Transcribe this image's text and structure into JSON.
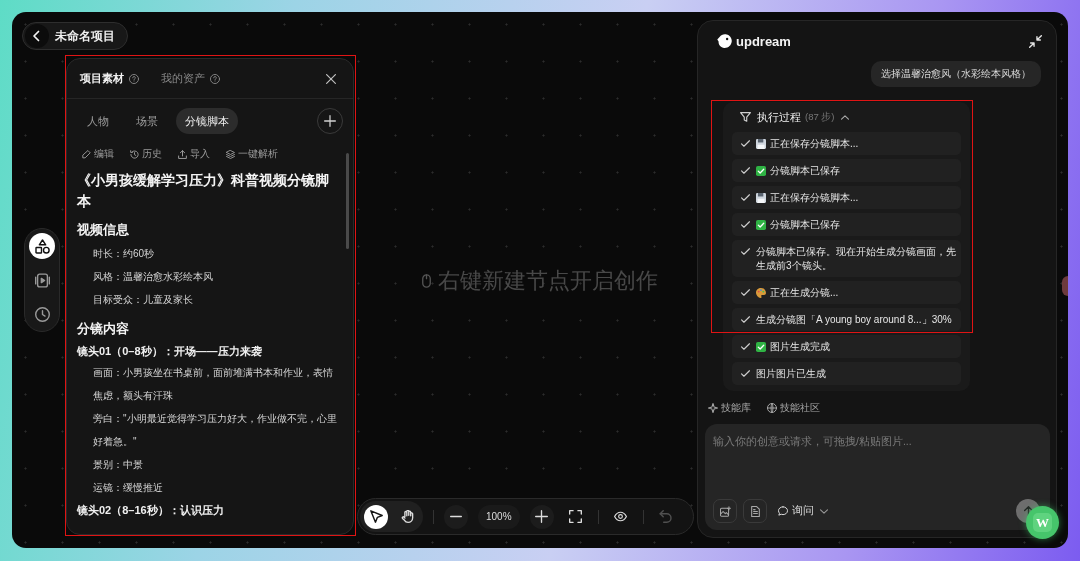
{
  "project": {
    "title": "未命名项目"
  },
  "rail": {
    "items": [
      {
        "kind": "shapes",
        "selected": true
      },
      {
        "kind": "video",
        "selected": false
      },
      {
        "kind": "history",
        "selected": false
      }
    ]
  },
  "asset_panel": {
    "highlighted": true,
    "header_tabs": [
      {
        "label": "项目素材",
        "selected": true
      },
      {
        "label": "我的资产",
        "selected": false
      }
    ],
    "category_tabs": [
      {
        "label": "人物",
        "selected": false
      },
      {
        "label": "场景",
        "selected": false
      },
      {
        "label": "分镜脚本",
        "selected": true
      }
    ],
    "actions": [
      {
        "kind": "edit",
        "label": "编辑"
      },
      {
        "kind": "history",
        "label": "历史"
      },
      {
        "kind": "import",
        "label": "导入"
      },
      {
        "kind": "parse",
        "label": "一键解析"
      }
    ],
    "document": {
      "title": "《小男孩缓解学习压力》科普视频分镜脚本",
      "blocks": [
        {
          "kind": "heading",
          "text": "视频信息"
        },
        {
          "kind": "item",
          "text": "时长：约60秒"
        },
        {
          "kind": "item",
          "text": "风格：温馨治愈水彩绘本风"
        },
        {
          "kind": "item",
          "text": "目标受众：儿童及家长"
        },
        {
          "kind": "heading",
          "text": "分镜内容"
        },
        {
          "kind": "subheading",
          "text": "镜头01（0–8秒）：开场——压力来袭"
        },
        {
          "kind": "item",
          "text": "画面：小男孩坐在书桌前，面前堆满书本和作业，表情焦虑，额头有汗珠"
        },
        {
          "kind": "item",
          "text": "旁白：\"小明最近觉得学习压力好大，作业做不完，心里好着急。\""
        },
        {
          "kind": "item",
          "text": "景别：中景"
        },
        {
          "kind": "item",
          "text": "运镜：缓慢推近"
        },
        {
          "kind": "subheading",
          "text": "镜头02（8–16秒）：认识压力"
        }
      ]
    }
  },
  "canvas": {
    "hint": "右键新建节点开启创作"
  },
  "toolbar": {
    "tools": [
      {
        "kind": "select",
        "selected": true
      },
      {
        "kind": "hand",
        "selected": false
      }
    ],
    "zoom": "100%",
    "undo": {
      "disabled": true
    }
  },
  "chat": {
    "brand": "updream",
    "messages": [
      {
        "text": "选择温馨治愈风（水彩绘本风格）"
      }
    ],
    "process": {
      "title": "执行过程",
      "count": "(87 步)",
      "expanded": true,
      "steps": [
        {
          "kind": "saving",
          "text": "正在保存分镜脚本...",
          "highlighted": true
        },
        {
          "kind": "done",
          "text": "分镜脚本已保存",
          "highlighted": true
        },
        {
          "kind": "saving",
          "text": "正在保存分镜脚本...",
          "highlighted": true
        },
        {
          "kind": "done",
          "text": "分镜脚本已保存",
          "highlighted": true
        },
        {
          "kind": "plain",
          "text": "分镜脚本已保存。现在开始生成分镜画面，先生成前3个镜头。",
          "highlighted": true
        },
        {
          "kind": "generating",
          "text": "正在生成分镜...",
          "highlighted": true
        },
        {
          "kind": "plain",
          "text": "生成分镜图「A young boy around 8...」30%",
          "highlighted": true
        },
        {
          "kind": "done",
          "text": "图片生成完成",
          "highlighted": false
        },
        {
          "kind": "plain",
          "text": "图片图片已生成",
          "highlighted": false
        }
      ]
    },
    "links": [
      {
        "kind": "skills",
        "label": "技能库"
      },
      {
        "kind": "community",
        "label": "技能社区"
      }
    ],
    "composer": {
      "placeholder": "输入你的创意或请求，可拖拽/粘贴图片...",
      "mode": "询问"
    }
  },
  "floating_button": {
    "label": "W"
  }
}
